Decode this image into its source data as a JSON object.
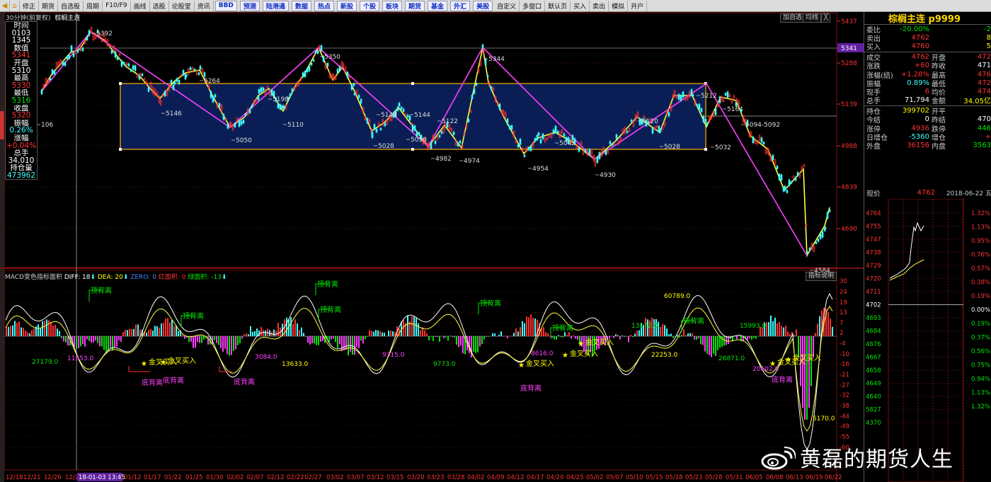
{
  "toolbar": {
    "items": [
      "修正",
      "期货",
      "自选股",
      "周期",
      "F10/F9",
      "画线",
      "选股",
      "论股堂",
      "资讯"
    ],
    "blue_items": [
      "BBD",
      "预测",
      "陆港通",
      "数据",
      "热点",
      "新股",
      "个股",
      "板块",
      "期货",
      "基金",
      "外汇",
      "美股"
    ],
    "tail_items": [
      "自定义",
      "多窗口",
      "默认页",
      "买入",
      "卖出",
      "模拟",
      "开户"
    ]
  },
  "chart_header": {
    "period": "30分钟(前复权)",
    "symbol": "棕榈主连",
    "btn_add": "加自选",
    "btn_ma": "均线",
    "btn_close": "╳"
  },
  "infobox": [
    {
      "t": "时间",
      "c": "white"
    },
    {
      "t": "0103",
      "c": "white"
    },
    {
      "t": "1345",
      "c": "white"
    },
    {
      "t": "数值",
      "c": "white"
    },
    {
      "t": "5341",
      "c": "red"
    },
    {
      "t": "开盘",
      "c": "white"
    },
    {
      "t": "5310",
      "c": "white"
    },
    {
      "t": "最高",
      "c": "white"
    },
    {
      "t": "5330",
      "c": "red"
    },
    {
      "t": "最低",
      "c": "white"
    },
    {
      "t": "5316",
      "c": "green"
    },
    {
      "t": "收盘",
      "c": "white"
    },
    {
      "t": "5320",
      "c": "red"
    },
    {
      "t": "振幅",
      "c": "white"
    },
    {
      "t": "0.26%",
      "c": "cyan"
    },
    {
      "t": "涨幅",
      "c": "white"
    },
    {
      "t": "+0.04%",
      "c": "red"
    },
    {
      "t": "总手",
      "c": "white"
    },
    {
      "t": "34,010",
      "c": "white"
    },
    {
      "t": "持仓量",
      "c": "white"
    },
    {
      "t": "473962",
      "c": "cyan"
    }
  ],
  "price_axis": [
    "5437",
    "5341",
    "5288",
    "5139",
    "4988",
    "4839",
    "4690"
  ],
  "macd_axis": [
    "30",
    "24",
    "19",
    "13",
    "7",
    "2",
    "-4",
    "-10",
    "-16",
    "-21",
    "-27",
    "-32",
    "-38",
    "-44",
    "-49",
    "-55",
    "-60"
  ],
  "dates": [
    "12/18",
    "12/21",
    "12/26",
    "12/2",
    "18-01-03 13:45",
    "01/12",
    "01/17",
    "01/22",
    "01/25",
    "01/30",
    "02/02",
    "02/07",
    "02/12",
    "02/22",
    "02/27",
    "03/02",
    "03/07",
    "03/12",
    "03/15",
    "03/20",
    "03/23",
    "03/28",
    "04/02",
    "04/09",
    "04/12",
    "04/17",
    "04/20",
    "04/25",
    "05/02",
    "05/07",
    "05/10",
    "05/15",
    "05/18",
    "05/23",
    "05/28",
    "05/31",
    "06/05",
    "06/08",
    "06/13",
    "06/19",
    "06/22"
  ],
  "pivot_labels": [
    "5392",
    "5350",
    "5344",
    "5264",
    "5212",
    "5198",
    "5164",
    "5146",
    "5110",
    "5050",
    "5028",
    "5144",
    "5144",
    "5122",
    "5058",
    "4982",
    "4974",
    "5042",
    "4954",
    "4930",
    "5120",
    "5028",
    "5032",
    "5094-5092",
    "4584",
    "106"
  ],
  "macd_header": {
    "name": "MACD变色指标面积",
    "diff": "DIFF: 18",
    "dea": "DEA: 20",
    "zero": "ZERO: 0",
    "red_area": "红面积: 0",
    "green_area": "绿面积: -13",
    "help": "指标说明"
  },
  "macd_labels": {
    "top_div": "顶背离",
    "bottom_div": "底背离",
    "golden": "金叉买入",
    "values": [
      "27179.0",
      "11653.0",
      "13633.0",
      "9773.0",
      "8616.0",
      "60789.0",
      "26871.0",
      "20602.0",
      "5170.0",
      "13172.0",
      "3084.0",
      "22253.0",
      "15993.0",
      "9315.0"
    ]
  },
  "rpanel": {
    "title": "棕榈主连 p9999",
    "rows1": [
      {
        "l1": "委比",
        "v1": "-20.00%",
        "c1": "green",
        "l2": "",
        "v2": "-2",
        "c2": "green"
      },
      {
        "l1": "卖出",
        "v1": "4762",
        "c1": "red",
        "l2": "",
        "v2": "8",
        "c2": "yellow"
      },
      {
        "l1": "买入",
        "v1": "4760",
        "c1": "red",
        "l2": "",
        "v2": "5",
        "c2": "yellow"
      }
    ],
    "rows2": [
      {
        "l1": "成交",
        "v1": "4762",
        "c1": "red",
        "l2": "开盘",
        "v2": "472",
        "c2": "red"
      },
      {
        "l1": "涨跌",
        "v1": "+60",
        "c1": "red",
        "l2": "昨收",
        "v2": "471",
        "c2": "white"
      },
      {
        "l1": "涨幅(结)",
        "v1": "+1.28%",
        "c1": "red",
        "l2": "最高",
        "v2": "476",
        "c2": "red"
      },
      {
        "l1": "振幅",
        "v1": "0.89%",
        "c1": "cyan",
        "l2": "最低",
        "v2": "472",
        "c2": "red"
      },
      {
        "l1": "现手",
        "v1": "6",
        "c1": "red",
        "l2": "均价",
        "v2": "474",
        "c2": "red"
      },
      {
        "l1": "总手",
        "v1": "71,794",
        "c1": "white",
        "l2": "金额",
        "v2": "34.05亿",
        "c2": "yellow"
      }
    ],
    "rows3": [
      {
        "l1": "持仓",
        "v1": "399702",
        "c1": "yellow",
        "l2": "开平",
        "v2": "",
        "c2": "white"
      },
      {
        "l1": "今结",
        "v1": "0",
        "c1": "white",
        "l2": "昨结",
        "v2": "470",
        "c2": "white"
      },
      {
        "l1": "涨停",
        "v1": "4936",
        "c1": "red",
        "l2": "跌停",
        "v2": "446",
        "c2": "green"
      },
      {
        "l1": "日增仓",
        "v1": "-5360",
        "c1": "cyan",
        "l2": "增仓",
        "v2": "+",
        "c2": "red"
      },
      {
        "l1": "外盘",
        "v1": "36156",
        "c1": "red",
        "l2": "内盘",
        "v2": "3563",
        "c2": "green"
      }
    ],
    "now_label": "现价",
    "now_value": "4762",
    "now_date": "2018-06-22 五",
    "intraday_left": [
      "4764",
      "4755",
      "4747",
      "4738",
      "4729",
      "4720",
      "4711",
      "4702",
      "4693",
      "4684",
      "4676",
      "4667",
      "4658",
      "4649",
      "4640",
      "5827",
      "4370"
    ],
    "intraday_right": [
      "1.32%",
      "1.13%",
      "0.95%",
      "0.76%",
      "0.57%",
      "0.38%",
      "0.19%",
      "0.00%",
      "0.19%",
      "0.37%",
      "0.56%",
      "0.75%",
      "0.94%",
      "1.13%",
      "1.32%"
    ]
  },
  "watermark": "黄磊的期货人生"
}
